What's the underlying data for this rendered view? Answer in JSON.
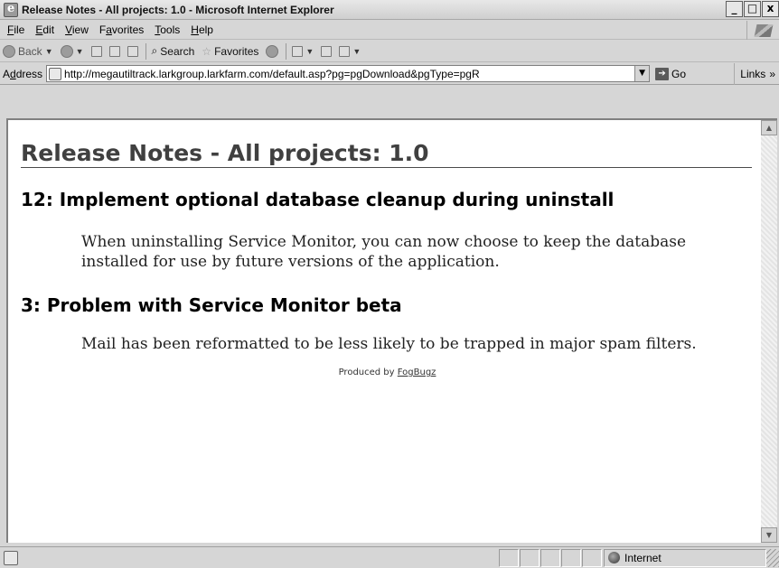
{
  "window": {
    "title": "Release Notes - All projects: 1.0 - Microsoft Internet Explorer",
    "controls": {
      "minimize": "_",
      "maximize": "□",
      "close": "x"
    }
  },
  "menu": {
    "items": [
      {
        "key": "F",
        "rest": "ile"
      },
      {
        "key": "E",
        "rest": "dit"
      },
      {
        "key": "V",
        "rest": "iew"
      },
      {
        "pre": "F",
        "key": "a",
        "rest": "vorites"
      },
      {
        "key": "T",
        "rest": "ools"
      },
      {
        "key": "H",
        "rest": "elp"
      }
    ]
  },
  "toolbar": {
    "back": "Back",
    "search": "Search",
    "favorites": "Favorites"
  },
  "address": {
    "label_key": "d",
    "label_pre": "A",
    "label_rest": "dress",
    "url": "http://megautiltrack.larkgroup.larkfarm.com/default.asp?pg=pgDownload&pgType=pgR",
    "go": "Go",
    "links": "Links",
    "links_more": "»"
  },
  "page": {
    "title": "Release Notes - All projects: 1.0",
    "notes": [
      {
        "heading": "12: Implement optional database cleanup during uninstall",
        "body": "When uninstalling Service Monitor, you can now choose to keep the database installed for use by future versions of the application."
      },
      {
        "heading": "3: Problem with Service Monitor beta",
        "body": "Mail has been reformatted to be less likely to be trapped in major spam filters."
      }
    ],
    "produced_by": "Produced by",
    "produced_link": "FogBugz"
  },
  "status": {
    "text": "",
    "zone": "Internet"
  },
  "icons": {
    "app": "ie-icon",
    "back": "back-arrow-icon",
    "forward": "forward-arrow-icon",
    "stop": "stop-icon",
    "refresh": "refresh-icon",
    "home": "home-icon",
    "search": "search-icon",
    "favorites": "star-icon",
    "history": "history-icon",
    "mail": "mail-icon",
    "print": "print-icon",
    "edit": "edit-icon",
    "go": "go-arrow-icon",
    "zone": "globe-icon"
  }
}
